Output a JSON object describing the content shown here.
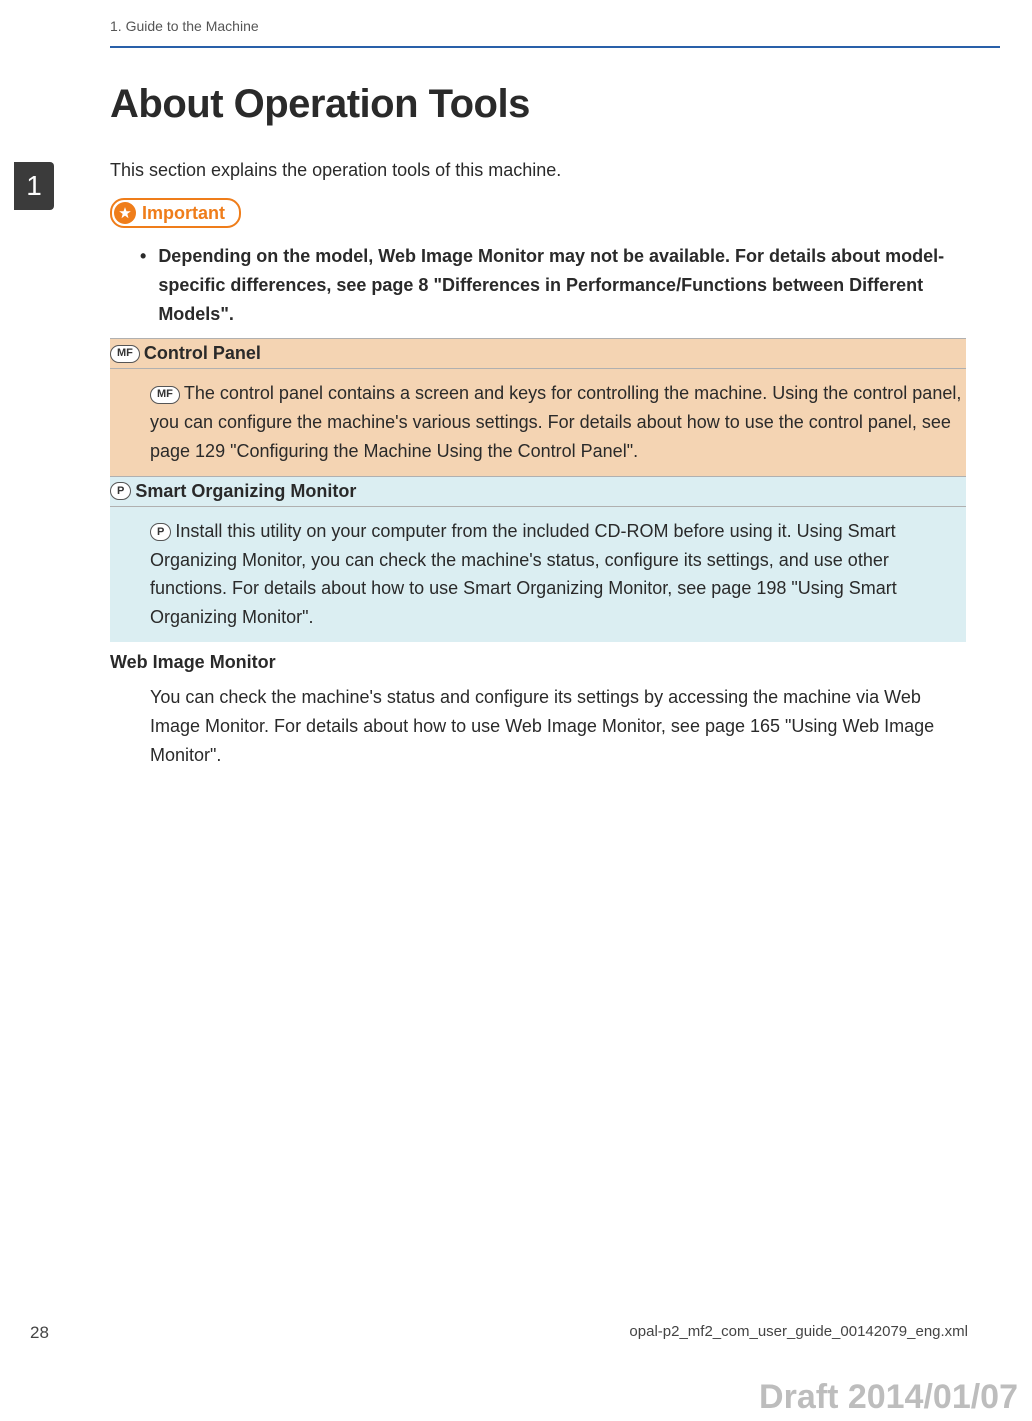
{
  "header": {
    "breadcrumb": "1. Guide to the Machine"
  },
  "tab": "1",
  "title": "About Operation Tools",
  "intro": "This section explains the operation tools of this machine.",
  "important": {
    "label": "Important",
    "bullet": "Depending on the model, Web Image Monitor may not be available. For details about model-specific differences, see page 8 \"Differences in Performance/Functions between Different Models\"."
  },
  "sections": {
    "mf": {
      "badge": "MF",
      "title": "Control Panel",
      "body": "The control panel contains a screen and keys for controlling the machine. Using the control panel, you can configure the machine's various settings. For details about how to use the control panel, see page 129 \"Configuring the Machine Using the Control Panel\"."
    },
    "p": {
      "badge": "P",
      "title": "Smart Organizing Monitor",
      "body": "Install this utility on your computer from the included CD-ROM before using it. Using Smart Organizing Monitor, you can check the machine's status, configure its settings, and use other functions. For details about how to use Smart Organizing Monitor, see page 198 \"Using Smart Organizing Monitor\"."
    },
    "web": {
      "title": "Web Image Monitor",
      "body": "You can check the machine's status and configure its settings by accessing the machine via Web Image Monitor. For details about how to use Web Image Monitor, see page 165 \"Using Web Image Monitor\"."
    }
  },
  "footer": {
    "page": "28",
    "filename": "opal-p2_mf2_com_user_guide_00142079_eng.xml"
  },
  "draft": "Draft 2014/01/07"
}
